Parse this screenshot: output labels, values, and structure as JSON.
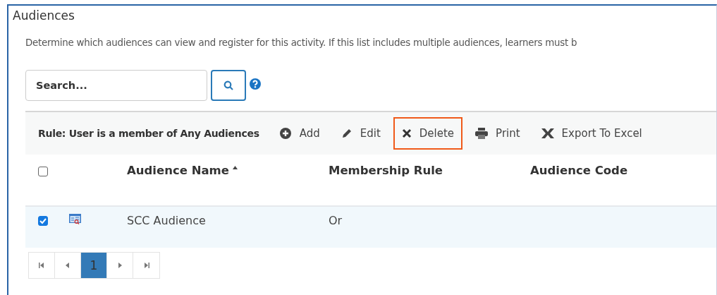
{
  "panel": {
    "title": "Audiences",
    "description": "Determine which audiences can view and register for this activity. If this list includes multiple audiences, learners must b"
  },
  "search": {
    "placeholder": "Search..."
  },
  "toolbar": {
    "rule": "Rule: User is a member of Any Audiences",
    "actions": [
      {
        "kind": "add",
        "label": "Add",
        "highlighted": false
      },
      {
        "kind": "edit",
        "label": "Edit",
        "highlighted": false
      },
      {
        "kind": "delete",
        "label": "Delete",
        "highlighted": true
      },
      {
        "kind": "print",
        "label": "Print",
        "highlighted": false
      },
      {
        "kind": "excel",
        "label": "Export To Excel",
        "highlighted": false
      }
    ]
  },
  "table": {
    "select_all": {
      "checked": false
    },
    "columns": [
      {
        "label": "Audience Name",
        "sorted": true
      },
      {
        "label": "Membership Rule",
        "sorted": false
      },
      {
        "label": "Audience Code",
        "sorted": false
      }
    ],
    "rows": [
      {
        "checked": true,
        "cells": [
          "SCC Audience",
          "Or",
          ""
        ]
      }
    ]
  },
  "pager": {
    "pages": [
      {
        "label": "1",
        "selected": true
      }
    ]
  }
}
